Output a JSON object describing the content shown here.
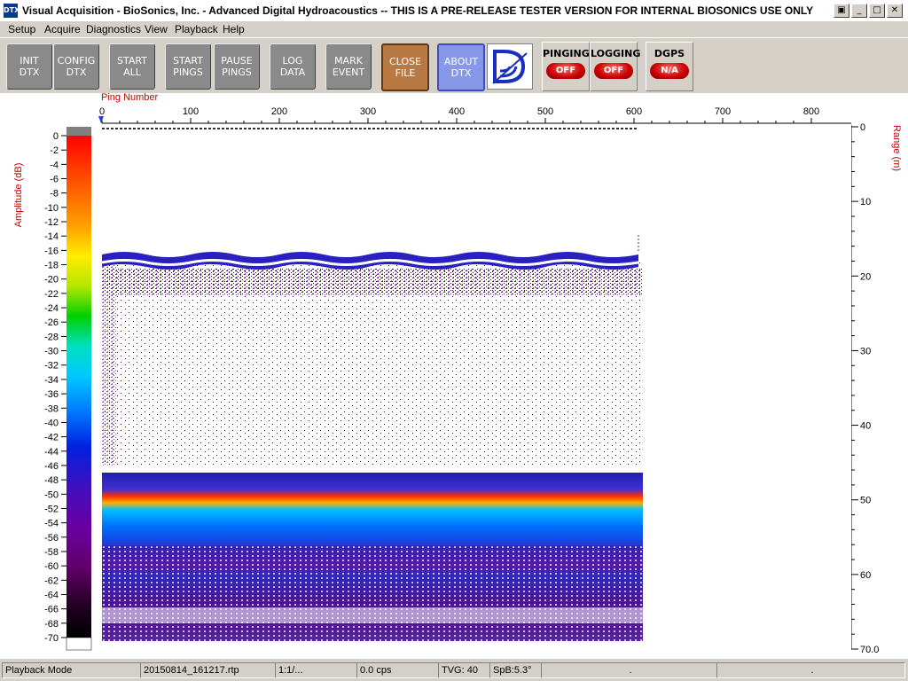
{
  "titlebar": {
    "icon_text": "DTX",
    "title": "Visual Acquisition  -  BioSonics, Inc.  -  Advanced Digital Hydroacoustics  -- THIS IS A PRE-RELEASE TESTER VERSION FOR INTERNAL BIOSONICS USE ONLY",
    "restore_glyph": "▣",
    "minimize_glyph": "_",
    "maximize_glyph": "□",
    "close_glyph": "✕"
  },
  "menu": [
    "Setup",
    "Acquire",
    "Diagnostics",
    "View",
    "Playback",
    "Help"
  ],
  "toolbar": {
    "buttons": [
      "INIT\nDTX",
      "CONFIG\nDTX",
      "START\nALL",
      "START\nPINGS",
      "PAUSE\nPINGS",
      "LOG\nDATA",
      "MARK\nEVENT",
      "CLOSE\nFILE",
      "ABOUT\nDTX"
    ],
    "indicators": [
      {
        "label": "PINGING",
        "state": "OFF"
      },
      {
        "label": "LOGGING",
        "state": "OFF"
      },
      {
        "label": "DGPS",
        "state": "N/A"
      }
    ]
  },
  "plot": {
    "x_title": "Ping Number",
    "x_ticks": [
      "0",
      "100",
      "200",
      "300",
      "400",
      "500",
      "600",
      "700",
      "800"
    ],
    "y_title": "Range (m)",
    "y_ticks": [
      "0",
      "10",
      "20",
      "30",
      "40",
      "50",
      "60",
      "70.0"
    ],
    "scale_title": "Amplitude (dB)",
    "scale_ticks": [
      "0",
      "-2",
      "-4",
      "-6",
      "-8",
      "-10",
      "-12",
      "-14",
      "-16",
      "-18",
      "-20",
      "-22",
      "-24",
      "-26",
      "-28",
      "-30",
      "-32",
      "-34",
      "-36",
      "-38",
      "-40",
      "-42",
      "-44",
      "-46",
      "-48",
      "-50",
      "-52",
      "-54",
      "-56",
      "-58",
      "-60",
      "-62",
      "-64",
      "-66",
      "-68",
      "-70"
    ]
  },
  "status": [
    "Playback Mode",
    "20150814_161217.rtp",
    "1:1/...",
    "0.0 cps",
    "TVG: 40",
    "SpB:5.3°",
    ".",
    "."
  ]
}
